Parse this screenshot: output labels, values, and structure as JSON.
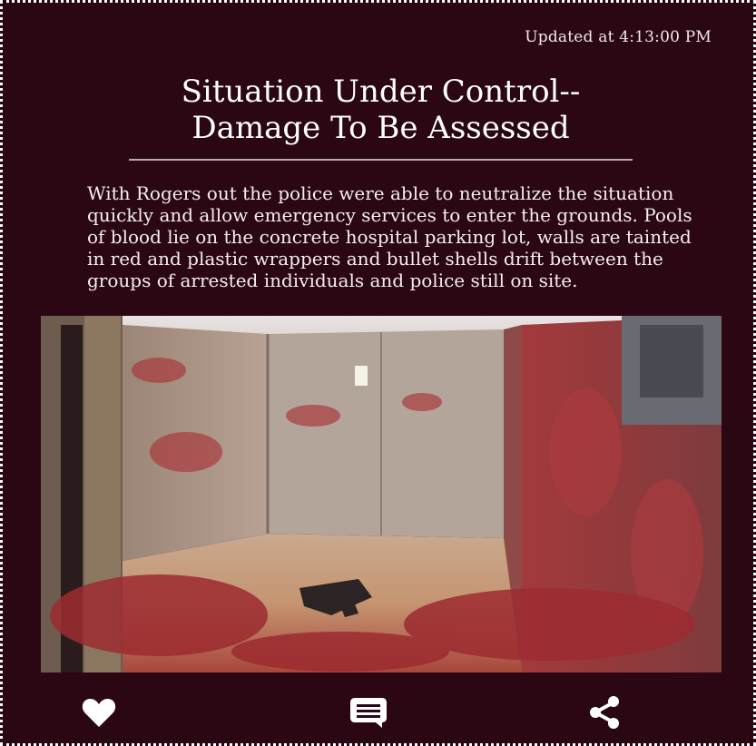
{
  "updated_text": "Updated at 4:13:00 PM",
  "article": {
    "title": "Situation Under Control--\nDamage To Be Assessed",
    "body": "With Rogers out the police were able to neutralize the situation quickly and allow emergency services to enter the grounds. Pools of blood lie on the concrete hospital parking lot, walls are tainted in red and plastic wrappers and bullet shells drift between the groups of arrested individuals and police still on site."
  },
  "actions": [
    {
      "name": "like",
      "icon": "heart-icon"
    },
    {
      "name": "comment",
      "icon": "comment-icon"
    },
    {
      "name": "share",
      "icon": "share-icon"
    }
  ],
  "colors": {
    "background": "#2a0713",
    "text": "#ffffff",
    "border": "#ffffff",
    "rule": "#b9a9af"
  }
}
